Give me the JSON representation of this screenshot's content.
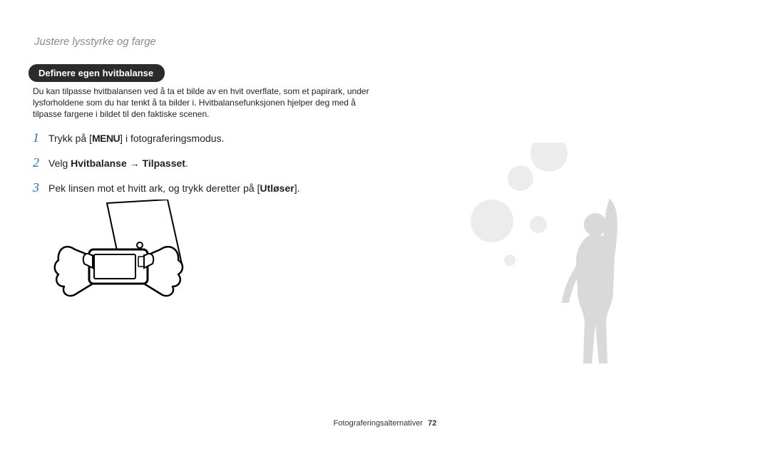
{
  "header": {
    "title": "Justere lysstyrke og farge"
  },
  "section": {
    "pill": "Definere egen hvitbalanse"
  },
  "intro": "Du kan tilpasse hvitbalansen ved å ta et bilde av en hvit overflate, som et papirark, under lysforholdene som du har tenkt å ta bilder i. Hvitbalansefunksjonen hjelper deg med å tilpasse fargene i bildet til den faktiske scenen.",
  "steps": {
    "s1": {
      "num": "1",
      "pre": "Trykk på [",
      "menu": "MENU",
      "post": "] i fotograferingsmodus."
    },
    "s2": {
      "num": "2",
      "pre": "Velg ",
      "bold1": "Hvitbalanse",
      "arrow": " → ",
      "bold2": "Tilpasset",
      "post": "."
    },
    "s3": {
      "num": "3",
      "pre": "Pek linsen mot et hvitt ark, og trykk deretter på [",
      "bold": "Utløser",
      "post": "]."
    }
  },
  "footer": {
    "label": "Fotograferingsalternativer",
    "page": "72"
  }
}
